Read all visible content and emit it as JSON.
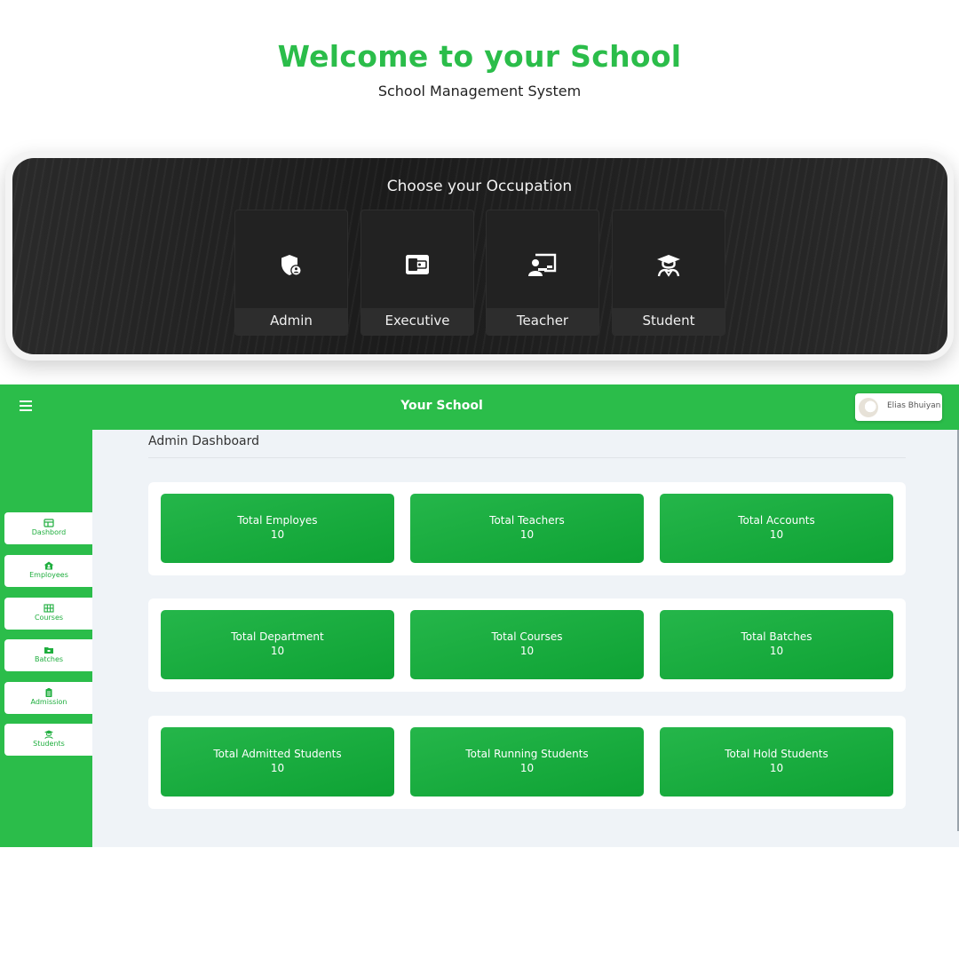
{
  "hero": {
    "title": "Welcome to your School",
    "subtitle": "School Management System"
  },
  "occupation": {
    "title": "Choose your Occupation",
    "options": [
      {
        "label": "Admin",
        "icon": "shield-user-icon"
      },
      {
        "label": "Executive",
        "icon": "wallet-icon"
      },
      {
        "label": "Teacher",
        "icon": "teacher-board-icon"
      },
      {
        "label": "Student",
        "icon": "graduate-icon"
      }
    ]
  },
  "appbar": {
    "title": "Your School",
    "menu_icon": "hamburger-menu-icon",
    "user_name": "Elias Bhuiyan"
  },
  "sidebar": {
    "items": [
      {
        "label": "Dashbord",
        "icon": "dashboard-icon"
      },
      {
        "label": "Employees",
        "icon": "employees-icon"
      },
      {
        "label": "Courses",
        "icon": "courses-grid-icon"
      },
      {
        "label": "Batches",
        "icon": "batches-folder-icon"
      },
      {
        "label": "Admission",
        "icon": "admission-clipboard-icon"
      },
      {
        "label": "Students",
        "icon": "students-cap-icon"
      }
    ]
  },
  "dashboard": {
    "title": "Admin Dashboard",
    "rows": [
      [
        {
          "label": "Total Employes",
          "value": "10"
        },
        {
          "label": "Total Teachers",
          "value": "10"
        },
        {
          "label": "Total Accounts",
          "value": "10"
        }
      ],
      [
        {
          "label": "Total Department",
          "value": "10"
        },
        {
          "label": "Total Courses",
          "value": "10"
        },
        {
          "label": "Total Batches",
          "value": "10"
        }
      ],
      [
        {
          "label": "Total Admitted Students",
          "value": "10"
        },
        {
          "label": "Total Running Students",
          "value": "10"
        },
        {
          "label": "Total Hold Students",
          "value": "10"
        }
      ]
    ]
  },
  "colors": {
    "brand_green": "#2bbd4a",
    "card_green_dark": "#0ea234",
    "panel_dark": "#1e1e1e",
    "main_bg": "#eff3f7"
  }
}
